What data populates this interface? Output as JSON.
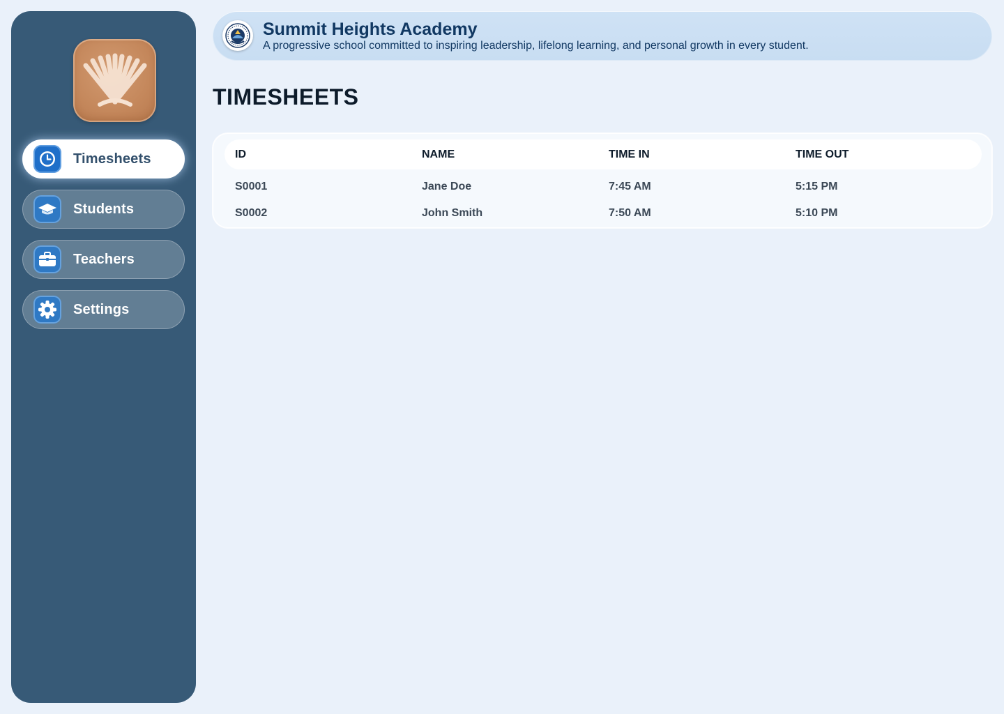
{
  "sidebar": {
    "items": [
      {
        "label": "Timesheets",
        "icon": "clock-icon",
        "active": true
      },
      {
        "label": "Students",
        "icon": "graduation-cap-icon",
        "active": false
      },
      {
        "label": "Teachers",
        "icon": "briefcase-icon",
        "active": false
      },
      {
        "label": "Settings",
        "icon": "gear-icon",
        "active": false
      }
    ]
  },
  "header": {
    "school_name": "Summit Heights Academy",
    "tagline": "A progressive school committed to inspiring leadership, lifelong learning, and personal growth in every student."
  },
  "main": {
    "title": "TIMESHEETS",
    "table": {
      "columns": [
        "ID",
        "NAME",
        "TIME IN",
        "TIME OUT"
      ],
      "rows": [
        [
          "S0001",
          "Jane Doe",
          "7:45 AM",
          "5:15 PM"
        ],
        [
          "S0002",
          "John Smith",
          "7:50 AM",
          "5:10 PM"
        ]
      ]
    }
  },
  "colors": {
    "sidebar_bg": "#375a77",
    "page_bg": "#eaf1fa",
    "accent": "#1f6fc9",
    "logo_bg": "#c4875b",
    "header_bg": "#cfe2f5",
    "heading_text": "#113862"
  }
}
